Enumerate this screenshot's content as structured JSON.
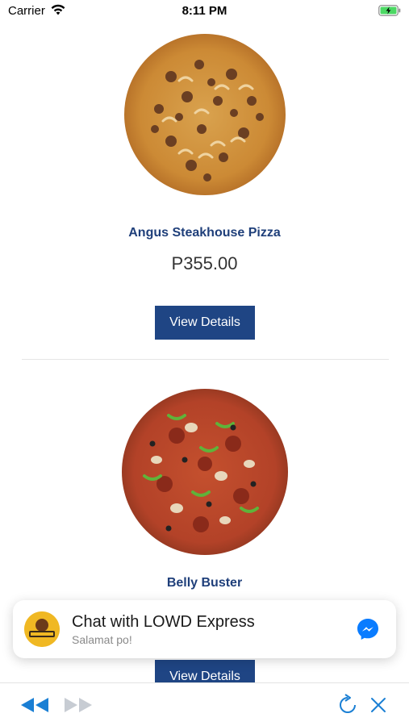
{
  "status_bar": {
    "carrier": "Carrier",
    "time": "8:11 PM"
  },
  "products": [
    {
      "name": "Angus Steakhouse Pizza",
      "price": "P355.00",
      "button_label": "View Details",
      "image": "pizza-angus-steakhouse"
    },
    {
      "name": "Belly Buster",
      "button_label": "View Details",
      "image": "pizza-belly-buster"
    }
  ],
  "chat_banner": {
    "title": "Chat with LOWD Express",
    "subtitle": "Salamat po!",
    "avatar": "lowd-express-logo",
    "icon": "messenger-icon"
  },
  "toolbar": {
    "back_icon": "rewind-icon",
    "forward_icon": "fast-forward-icon",
    "refresh_icon": "refresh-icon",
    "close_icon": "close-icon"
  },
  "colors": {
    "brand_navy": "#1f4584",
    "product_name": "#1f3f7a",
    "toolbar_blue": "#1a7fd4",
    "messenger_blue": "#0a7cff"
  }
}
